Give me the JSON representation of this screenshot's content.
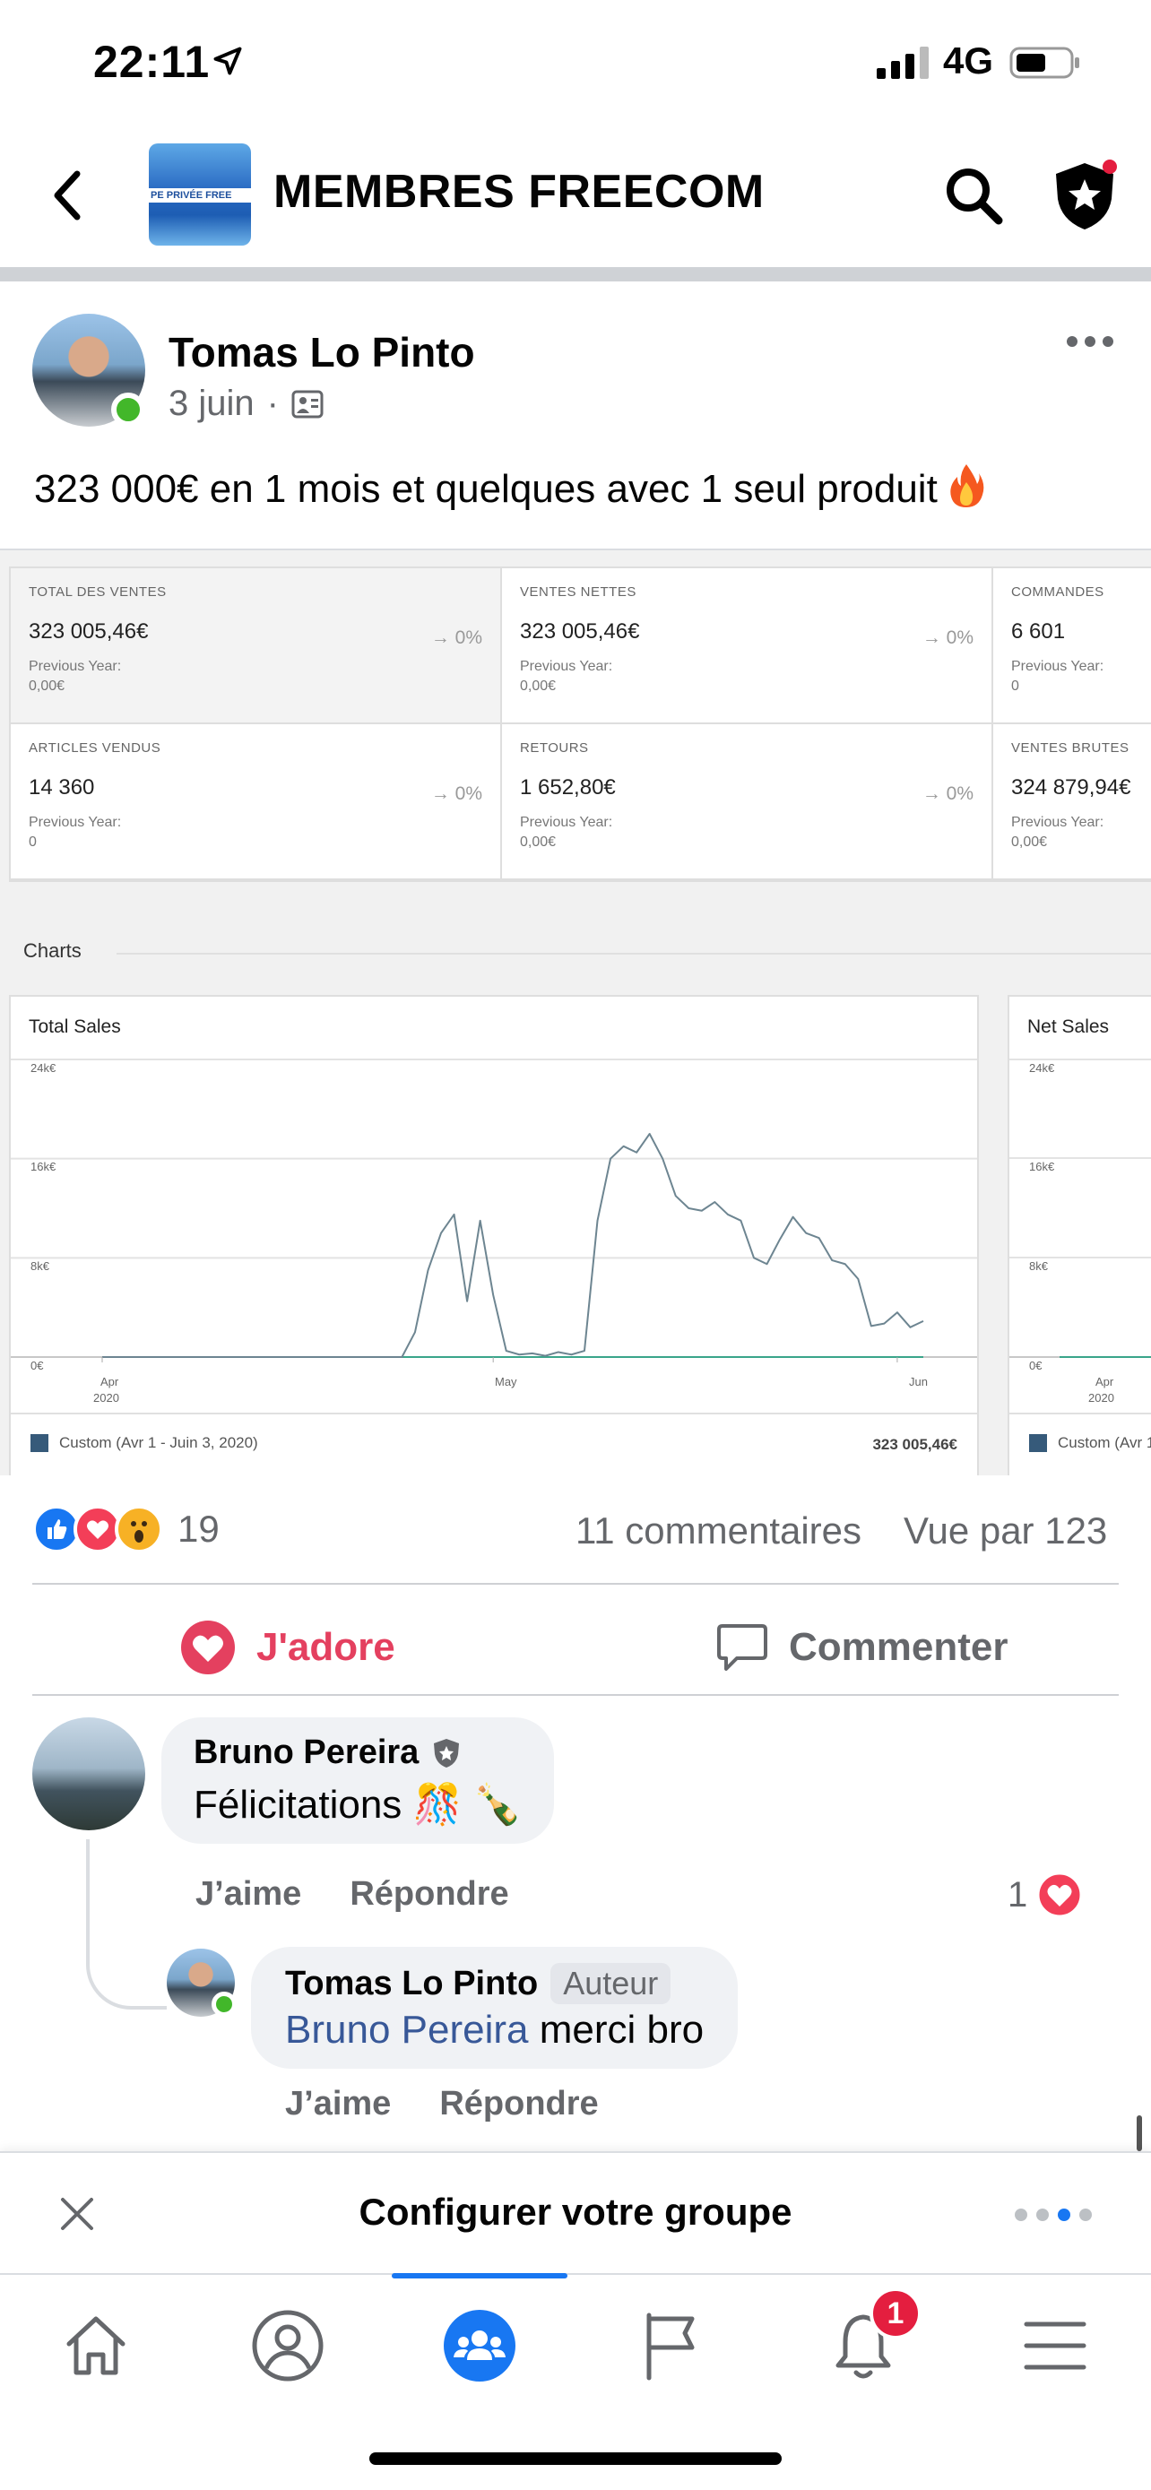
{
  "status_bar": {
    "time": "22:11",
    "network": "4G"
  },
  "header": {
    "title": "MEMBRES FREECOM",
    "thumb_text": "PE PRIVÉE  FREE"
  },
  "post": {
    "author": "Tomas Lo Pinto",
    "date": "3 juin",
    "separator": "·",
    "text": "323 000€ en 1 mois et quelques avec 1 seul produit",
    "image": {
      "stats": [
        {
          "label": "TOTAL DES VENTES",
          "value": "323 005,46€",
          "change": "→ 0%",
          "prev_label": "Previous Year:",
          "prev_value": "0,00€"
        },
        {
          "label": "VENTES NETTES",
          "value": "323 005,46€",
          "change": "→ 0%",
          "prev_label": "Previous Year:",
          "prev_value": "0,00€"
        },
        {
          "label": "COMMANDES",
          "value": "6 601",
          "change": "",
          "prev_label": "Previous Year:",
          "prev_value": "0"
        },
        {
          "label": "ARTICLES VENDUS",
          "value": "14 360",
          "change": "→ 0%",
          "prev_label": "Previous Year:",
          "prev_value": "0"
        },
        {
          "label": "RETOURS",
          "value": "1 652,80€",
          "change": "→ 0%",
          "prev_label": "Previous Year:",
          "prev_value": "0,00€"
        },
        {
          "label": "VENTES BRUTES",
          "value": "324 879,94€",
          "change": "",
          "prev_label": "Previous Year:",
          "prev_value": "0,00€"
        }
      ],
      "charts_heading": "Charts",
      "legend_label": "Custom (Avr 1 - Juin 3, 2020)",
      "legend_label_cut": "Custom (Avr 1",
      "total": "323 005,46€"
    }
  },
  "chart_data": [
    {
      "type": "line",
      "title": "Total Sales",
      "ylim": [
        0,
        24
      ],
      "y_unit": "k€",
      "y_ticks": [
        "0€",
        "8k€",
        "16k€",
        "24k€"
      ],
      "x_ticks": [
        "Apr 2020",
        "May",
        "Jun"
      ],
      "x_tick_label_apr": "Apr",
      "x_tick_label_year": "2020",
      "x_tick_label_may": "May",
      "x_tick_label_jun": "Jun",
      "series": [
        {
          "name": "Custom (Avr 1 - Juin 3, 2020)",
          "color": "#6d8591",
          "x": [
            "2020-04-01",
            "2020-04-05",
            "2020-04-10",
            "2020-04-15",
            "2020-04-20",
            "2020-04-24",
            "2020-04-25",
            "2020-04-26",
            "2020-04-27",
            "2020-04-28",
            "2020-04-29",
            "2020-04-30",
            "2020-05-01",
            "2020-05-02",
            "2020-05-03",
            "2020-05-04",
            "2020-05-05",
            "2020-05-06",
            "2020-05-07",
            "2020-05-08",
            "2020-05-09",
            "2020-05-10",
            "2020-05-11",
            "2020-05-12",
            "2020-05-13",
            "2020-05-14",
            "2020-05-15",
            "2020-05-16",
            "2020-05-17",
            "2020-05-18",
            "2020-05-19",
            "2020-05-20",
            "2020-05-21",
            "2020-05-22",
            "2020-05-23",
            "2020-05-24",
            "2020-05-25",
            "2020-05-26",
            "2020-05-27",
            "2020-05-28",
            "2020-05-29",
            "2020-05-30",
            "2020-05-31",
            "2020-06-01",
            "2020-06-02",
            "2020-06-03"
          ],
          "values": [
            0,
            0,
            0,
            0,
            0,
            0,
            2,
            7,
            10,
            11.5,
            4.5,
            11,
            5,
            0.5,
            0.2,
            0.3,
            0.1,
            0.4,
            0.2,
            0.5,
            11,
            16,
            17,
            16.5,
            18,
            16,
            13,
            12,
            11.8,
            12.5,
            11.5,
            11,
            8,
            7.5,
            9.5,
            11.3,
            10,
            9.6,
            7.8,
            7.5,
            6.3,
            2.5,
            2.7,
            3.6,
            2.4,
            2.9
          ]
        },
        {
          "name": "Previous Year",
          "color": "#3aa58a",
          "values": [
            0,
            0,
            0,
            0,
            0,
            0,
            0,
            0,
            0,
            0,
            0,
            0,
            0,
            0,
            0,
            0,
            0,
            0,
            0,
            0,
            0,
            0,
            0,
            0,
            0,
            0,
            0,
            0,
            0,
            0,
            0,
            0,
            0,
            0,
            0,
            0,
            0,
            0,
            0,
            0,
            0,
            0,
            0,
            0,
            0,
            0
          ]
        }
      ]
    },
    {
      "type": "line",
      "title": "Net Sales",
      "y_ticks": [
        "0€",
        "8k€",
        "16k€",
        "24k€"
      ],
      "x_ticks": [
        "Apr 2020"
      ]
    }
  ],
  "engagement": {
    "reaction_count": "19",
    "comments": "11 commentaires",
    "views": "Vue par 123",
    "love_label": "J'adore",
    "comment_label": "Commenter"
  },
  "comments": [
    {
      "author": "Bruno Pereira",
      "text": "Félicitations 🎊 🍾",
      "like_label": "J’aime",
      "reply_label": "Répondre",
      "reaction_count": "1",
      "reply": {
        "author": "Tomas Lo Pinto",
        "badge": "Auteur",
        "mention": "Bruno Pereira",
        "text": " merci bro",
        "like_label": "J’aime",
        "reply_label": "Répondre"
      }
    }
  ],
  "setup_banner": {
    "title": "Configurer votre groupe"
  },
  "bottom_nav": {
    "notification_count": "1"
  },
  "colors": {
    "accent": "#1877f2",
    "love": "#e4405f",
    "online": "#42b72a",
    "badge": "#e41e3f"
  }
}
